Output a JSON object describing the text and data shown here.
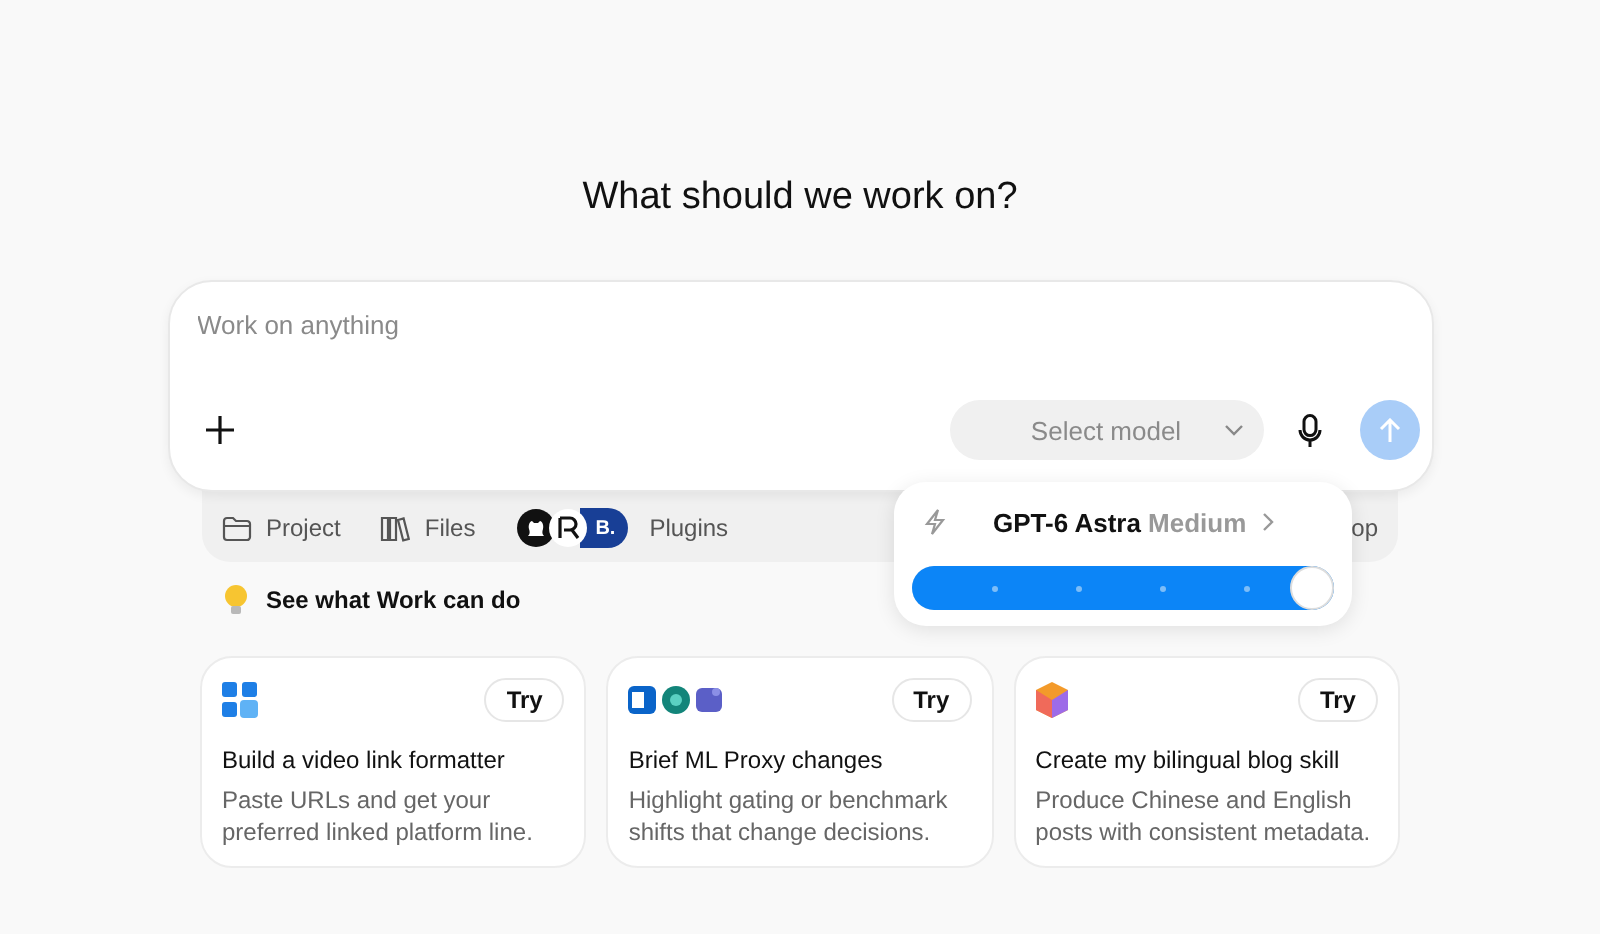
{
  "heading": "What should we work on?",
  "composer": {
    "placeholder": "Work on anything",
    "model_select": {
      "placeholder": "Select model"
    }
  },
  "toolbar": {
    "items": [
      {
        "kind": "folder",
        "label": "Project"
      },
      {
        "kind": "books",
        "label": "Files"
      },
      {
        "kind": "plugins",
        "label": "Plugins",
        "badge": "B."
      },
      {
        "kind": "cut",
        "label": "op"
      }
    ]
  },
  "model_popover": {
    "model": "GPT-6 Astra",
    "effort": "Medium",
    "level": 1.0
  },
  "hint": "See what Work can do",
  "cards": [
    {
      "kind": "tiles",
      "button": "Try",
      "title": "Build a video link formatter",
      "description": "Paste URLs and get your preferred linked platform line."
    },
    {
      "kind": "apps",
      "button": "Try",
      "title": "Brief ML Proxy changes",
      "description": "Highlight gating or benchmark shifts that change decisions."
    },
    {
      "kind": "cube",
      "button": "Try",
      "title": "Create my bilingual blog skill",
      "description": "Produce Chinese and English posts with consistent metadata."
    }
  ]
}
